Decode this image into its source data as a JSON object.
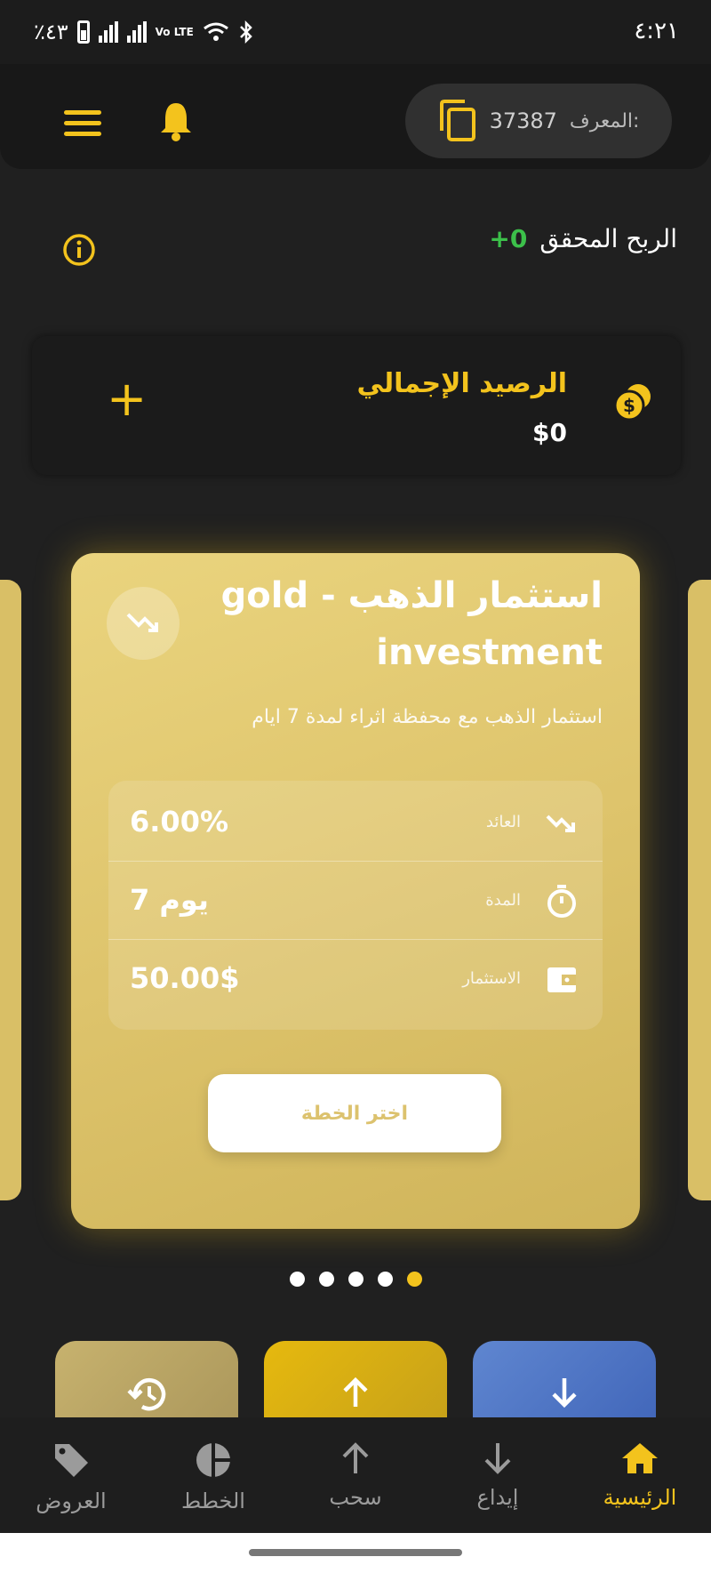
{
  "status_bar": {
    "time": "٤:٢١",
    "battery": "٪٤٣",
    "network": "Vo LTE"
  },
  "header": {
    "referrer_label": "المعرف:",
    "referrer_code": "37387"
  },
  "profit": {
    "label": "الربح المحقق",
    "value": "0+"
  },
  "balance": {
    "title": "الرصيد الإجمالي",
    "amount": "$0"
  },
  "plan": {
    "title": "استثمار الذهب - gold investment",
    "description": "استثمار الذهب مع محفظة اثراء لمدة 7 ايام",
    "stats": [
      {
        "label": "العائد",
        "value": "6.00%",
        "icon": "trend-icon"
      },
      {
        "label": "المدة",
        "value": "7 يوم",
        "icon": "timer-icon"
      },
      {
        "label": "الاستثمار",
        "value": "50.00$",
        "icon": "wallet-icon"
      }
    ],
    "button_label": "اختر الخطة"
  },
  "carousel": {
    "count": 5,
    "active_index": 4
  },
  "nav": {
    "home": "الرئيسية",
    "deposit": "إيداع",
    "withdraw": "سحب",
    "plans": "الخطط",
    "offers": "العروض"
  },
  "colors": {
    "accent": "#f3c31d",
    "profit": "#3cc04a",
    "deposit": "#4f75c4",
    "background": "#202020"
  }
}
